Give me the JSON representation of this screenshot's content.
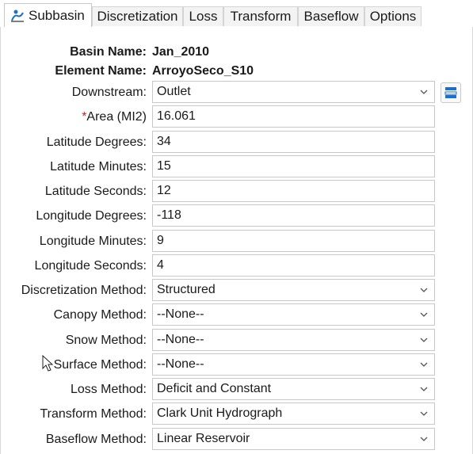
{
  "tabs": [
    {
      "label": "Subbasin",
      "icon": "subbasin-icon",
      "active": true
    },
    {
      "label": "Discretization"
    },
    {
      "label": "Loss"
    },
    {
      "label": "Transform"
    },
    {
      "label": "Baseflow"
    },
    {
      "label": "Options"
    }
  ],
  "info": {
    "basin_label": "Basin Name:",
    "basin_value": "Jan_2010",
    "element_label": "Element Name:",
    "element_value": "ArroyoSeco_S10"
  },
  "fields": {
    "downstream": {
      "label": "Downstream:",
      "value": "Outlet"
    },
    "area": {
      "required_mark": "*",
      "label": "Area (MI2)",
      "value": "16.061"
    },
    "lat_deg": {
      "label": "Latitude Degrees:",
      "value": "34"
    },
    "lat_min": {
      "label": "Latitude Minutes:",
      "value": "15"
    },
    "lat_sec": {
      "label": "Latitude Seconds:",
      "value": "12"
    },
    "lon_deg": {
      "label": "Longitude Degrees:",
      "value": "-118"
    },
    "lon_min": {
      "label": "Longitude Minutes:",
      "value": "9"
    },
    "lon_sec": {
      "label": "Longitude Seconds:",
      "value": "4"
    },
    "discretization": {
      "label": "Discretization Method:",
      "value": "Structured"
    },
    "canopy": {
      "label": "Canopy Method:",
      "value": "--None--"
    },
    "snow": {
      "label": "Snow Method:",
      "value": "--None--"
    },
    "surface": {
      "label": "Surface Method:",
      "value": "--None--"
    },
    "loss": {
      "label": "Loss Method:",
      "value": "Deficit and Constant"
    },
    "transform": {
      "label": "Transform Method:",
      "value": "Clark Unit Hydrograph"
    },
    "baseflow": {
      "label": "Baseflow Method:",
      "value": "Linear Reservoir"
    }
  },
  "colors": {
    "required": "#d21f1f",
    "icon_blue": "#1e6fc7"
  }
}
